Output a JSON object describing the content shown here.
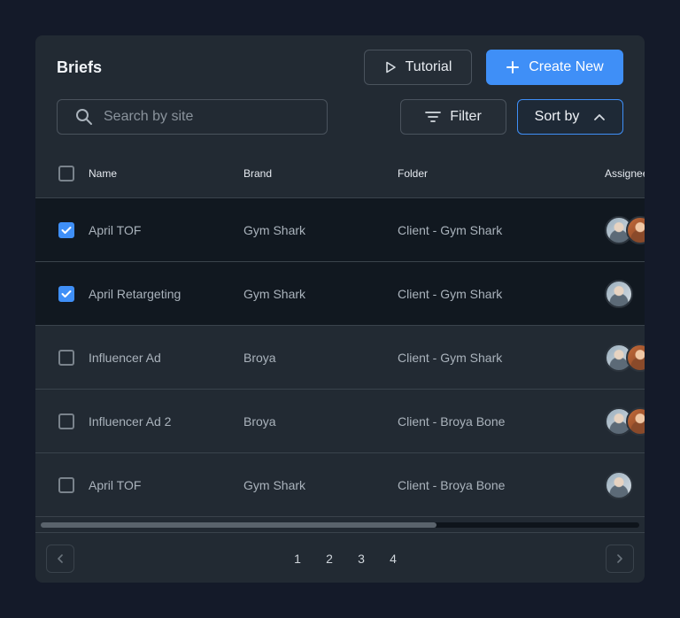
{
  "header": {
    "title": "Briefs",
    "tutorial_label": "Tutorial",
    "create_label": "Create New"
  },
  "toolbar": {
    "search_placeholder": "Search by site",
    "filter_label": "Filter",
    "sort_label": "Sort by"
  },
  "table": {
    "columns": [
      "Name",
      "Brand",
      "Folder",
      "Assignee"
    ],
    "rows": [
      {
        "name": "April TOF",
        "brand": "Gym Shark",
        "folder": "Client - Gym Shark",
        "checked": true,
        "assignees": 2
      },
      {
        "name": "April Retargeting",
        "brand": "Gym Shark",
        "folder": "Client - Gym Shark",
        "checked": true,
        "assignees": 1
      },
      {
        "name": "Influencer Ad",
        "brand": "Broya",
        "folder": "Client - Gym Shark",
        "checked": false,
        "assignees": 2
      },
      {
        "name": "Influencer Ad 2",
        "brand": "Broya",
        "folder": "Client - Broya Bone",
        "checked": false,
        "assignees": 2
      },
      {
        "name": "April TOF",
        "brand": "Gym Shark",
        "folder": "Client - Broya Bone",
        "checked": false,
        "assignees": 1
      }
    ]
  },
  "pagination": {
    "pages": [
      "1",
      "2",
      "3",
      "4"
    ]
  },
  "colors": {
    "accent": "#3f8ff7",
    "page_bg": "#141a29",
    "card_bg": "#222a33",
    "selected_row_bg": "#111820"
  },
  "icons": {
    "tutorial": "play-icon",
    "create": "plus-icon",
    "search": "search-icon",
    "filter": "filter-icon",
    "sort": "chevron-up-icon",
    "prev": "chevron-left-icon",
    "next": "chevron-right-icon",
    "check": "check-icon"
  }
}
